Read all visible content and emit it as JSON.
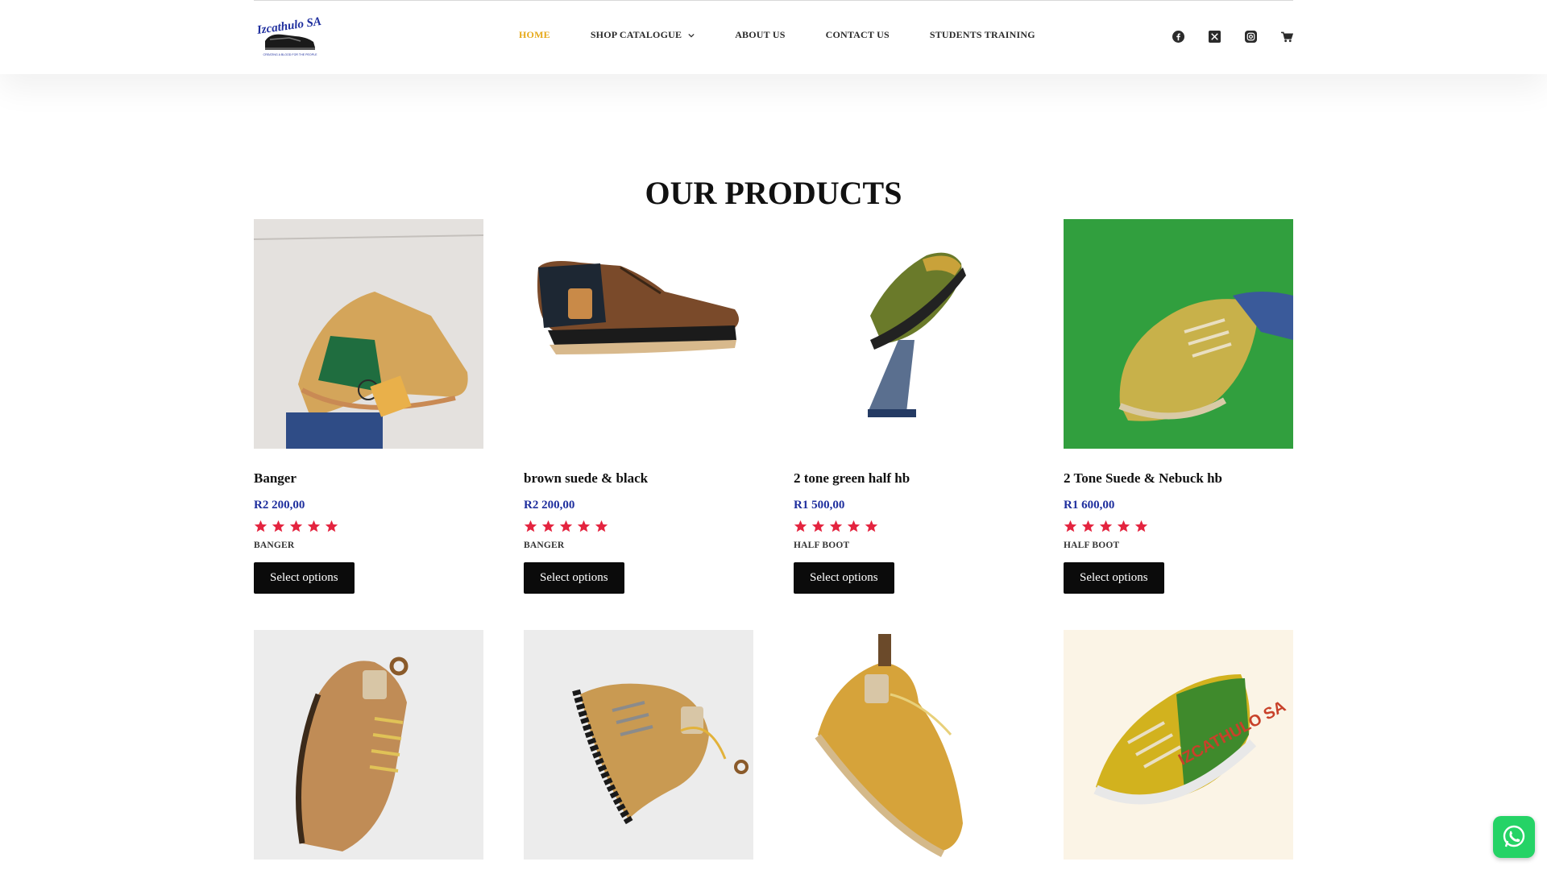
{
  "brand": {
    "logo_text": "Izcathulo SA",
    "logo_tagline": "CREATING A BLOOD FOR THE PEOPLE"
  },
  "nav": {
    "items": [
      {
        "label": "HOME",
        "active": true
      },
      {
        "label": "SHOP CATALOGUE",
        "has_dropdown": true
      },
      {
        "label": "ABOUT US"
      },
      {
        "label": "CONTACT US"
      },
      {
        "label": "STUDENTS TRAINING"
      }
    ],
    "socials": [
      "facebook-icon",
      "x-twitter-icon",
      "instagram-icon",
      "cart-icon"
    ]
  },
  "colors": {
    "accent": "#e6a817",
    "price": "#1f2f9e",
    "stars": "#e4243f",
    "button": "#0b0b0b",
    "whatsapp": "#25d366"
  },
  "section": {
    "title": "OUR PRODUCTS"
  },
  "products": [
    {
      "name": "Banger",
      "price": "R2 200,00",
      "rating": 5,
      "category": "BANGER",
      "button": "Select options"
    },
    {
      "name": "brown suede & black",
      "price": "R2 200,00",
      "rating": 5,
      "category": "BANGER",
      "button": "Select options"
    },
    {
      "name": "2 tone green half hb",
      "price": "R1 500,00",
      "rating": 5,
      "category": "HALF BOOT",
      "button": "Select options"
    },
    {
      "name": "2 Tone Suede & Nebuck hb",
      "price": "R1 600,00",
      "rating": 5,
      "category": "HALF BOOT",
      "button": "Select options"
    },
    {
      "name": "",
      "price": "",
      "rating": 0,
      "category": "",
      "button": ""
    },
    {
      "name": "",
      "price": "",
      "rating": 0,
      "category": "",
      "button": ""
    },
    {
      "name": "",
      "price": "",
      "rating": 0,
      "category": "",
      "button": ""
    },
    {
      "name": "",
      "price": "",
      "rating": 0,
      "category": "",
      "button": ""
    }
  ],
  "floating": {
    "whatsapp": "whatsapp-icon"
  }
}
